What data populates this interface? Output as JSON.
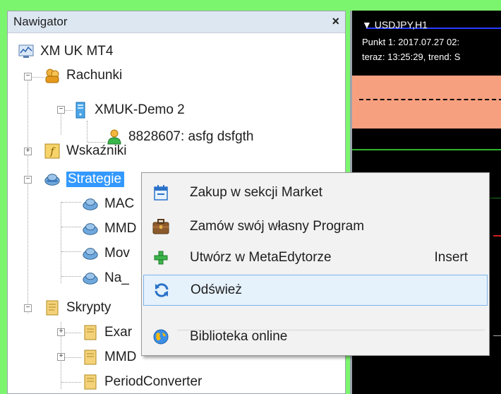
{
  "navigator": {
    "title": "Nawigator",
    "close_glyph": "×",
    "tree": {
      "root": "XM UK MT4",
      "accounts": "Rachunki",
      "server": "XMUK-Demo 2",
      "account_entry": "8828607: asfg dsfgth",
      "indicators": "Wskaźniki",
      "strategies": "Strategie",
      "strategy_items": [
        "MAC",
        "MMD",
        "Mov",
        "Na_"
      ],
      "scripts": "Skrypty",
      "script_items": [
        "Exar",
        "MMD",
        "PeriodConverter"
      ]
    }
  },
  "chart": {
    "symbol": "▼ USDJPY,H1",
    "point": "Punkt 1: 2017.07.27 02:",
    "now": "teraz: 13:25:29, trend: S"
  },
  "context_menu": {
    "items": [
      {
        "label": "Zakup w sekcji Market",
        "icon": "market-icon",
        "shortcut": ""
      },
      {
        "label": "Zamów swój własny Program",
        "icon": "briefcase-icon",
        "shortcut": ""
      },
      {
        "label": "Utwórz w MetaEdytorze",
        "icon": "plus-icon",
        "shortcut": "Insert"
      },
      {
        "label": "Odśwież",
        "icon": "refresh-icon",
        "shortcut": ""
      },
      {
        "label": "Biblioteka online",
        "icon": "globe-icon",
        "shortcut": ""
      }
    ]
  },
  "colors": {
    "background": "#7cf56e",
    "selection": "#3399ff",
    "hover_bg": "#e5f1fb",
    "hover_border": "#7eb4ea",
    "chart_band": "#f7a07f"
  }
}
